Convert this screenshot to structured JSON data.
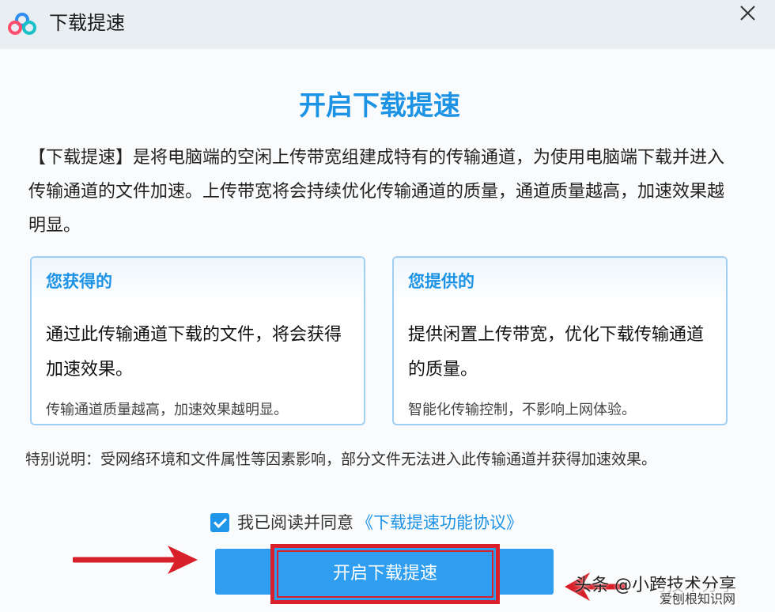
{
  "window": {
    "title": "下载提速",
    "close_icon": "close-icon"
  },
  "main": {
    "heading": "开启下载提速",
    "intro": "【下载提速】是将电脑端的空闲上传带宽组建成特有的传输通道，为使用电脑端下载并进入传输通道的文件加速。上传带宽将会持续优化传输通道的质量，通道质量越高，加速效果越明显。"
  },
  "cards": {
    "get": {
      "title": "您获得的",
      "body": "通过此传输通道下载的文件，将会获得加速效果。",
      "note": "传输通道质量越高，加速效果越明显。"
    },
    "provide": {
      "title": "您提供的",
      "body": "提供闲置上传带宽，优化下载传输通道的质量。",
      "note": "智能化传输控制，不影响上网体验。"
    }
  },
  "special_note": "特别说明：受网络环境和文件属性等因素影响，部分文件无法进入此传输通道并获得加速效果。",
  "agreement": {
    "checked": true,
    "text": "我已阅读并同意",
    "link": "《下载提速功能协议》"
  },
  "start_button": {
    "label": "开启下载提速"
  },
  "watermark": {
    "text": "头条 @小跨技术分享",
    "site": "爱刨根知识网"
  },
  "colors": {
    "accent": "#1d93e6",
    "highlight": "#d8202a",
    "titlebar": "#e9eef3"
  }
}
